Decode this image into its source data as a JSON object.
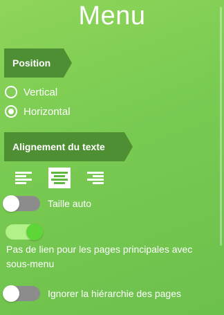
{
  "menu": {
    "title": "Menu"
  },
  "position": {
    "header": "Position",
    "options": [
      "Vertical",
      "Horizontal"
    ],
    "selected": "Horizontal"
  },
  "alignment": {
    "header": "Alignement du texte",
    "options": [
      "align-left-icon",
      "align-center-icon",
      "align-right-icon"
    ],
    "selected": "align-center-icon"
  },
  "toggles": {
    "auto_size": {
      "label": "Taille auto",
      "on": false
    },
    "no_link_parent": {
      "label": "Pas de lien pour les pages principales avec sous-menu",
      "on": true
    },
    "ignore_hierarchy": {
      "label": "Ignorer la hiérarchie des pages",
      "on": false
    }
  },
  "colors": {
    "panel_bg": "#7acb52",
    "tag_bg": "#4f8f34",
    "toggle_off": "#8c8c8c",
    "toggle_on_track": "#b2f08a",
    "toggle_on_knob": "#5fd638"
  }
}
